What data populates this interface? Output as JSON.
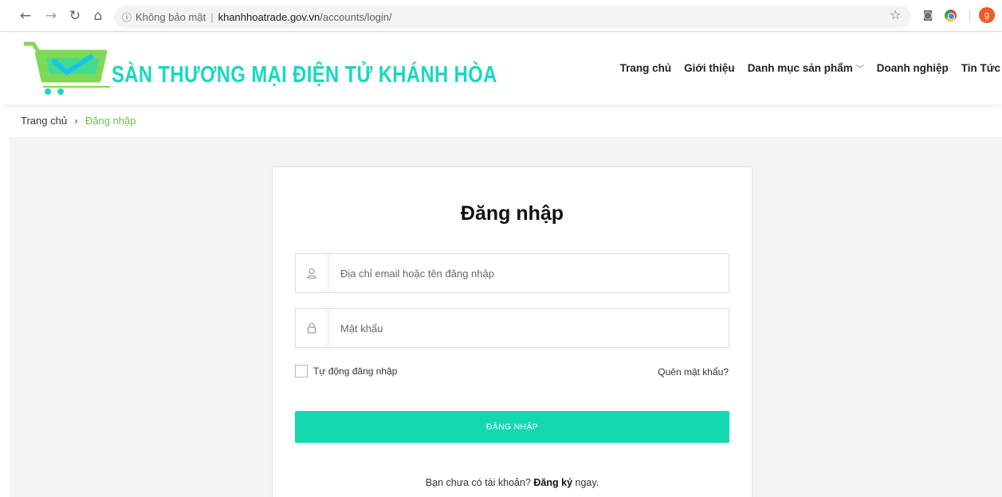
{
  "browser": {
    "back_icon": "arrow-left-icon",
    "forward_icon": "arrow-right-icon",
    "reload_icon": "reload-icon",
    "home_icon": "home-icon",
    "security_label": "Không bảo mật",
    "url_host": "khanhhoatrade.gov.vn",
    "url_path": "/accounts/login/",
    "avatar_letter": "g"
  },
  "site": {
    "logo_text": "SÀN THƯƠNG MẠI ĐIỆN TỬ KHÁNH HÒA",
    "brand_color": "#17d8c0",
    "cart_color": "#7ed957",
    "nav": [
      {
        "label": "Trang chủ"
      },
      {
        "label": "Giới thiệu"
      },
      {
        "label": "Danh mục sản phẩm"
      },
      {
        "label": "Doanh nghiệp"
      },
      {
        "label": "Tin Tức"
      }
    ]
  },
  "breadcrumb": {
    "home": "Trang chủ",
    "separator": "›",
    "current": "Đăng nhập"
  },
  "login": {
    "title": "Đăng nhập",
    "username_placeholder": "Địa chỉ email hoặc tên đăng nhập",
    "username_value": "",
    "password_placeholder": "Mật khẩu",
    "password_value": "",
    "remember_label": "Tự động đăng nhập",
    "remember_checked": false,
    "forgot_label": "Quên mật khẩu?",
    "submit_label": "ĐĂNG NHẬP",
    "button_color": "#14d9b0",
    "register_prefix": "Bạn chưa có tài khoản?",
    "register_link": "Đăng ký",
    "register_suffix": "ngay."
  }
}
